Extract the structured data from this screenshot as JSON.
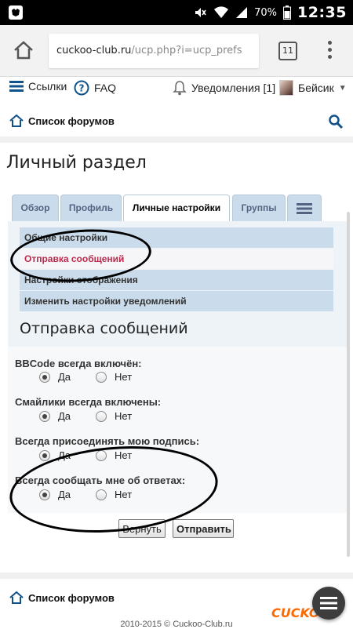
{
  "status_bar": {
    "battery_percent": "70%",
    "time": "12:35"
  },
  "browser": {
    "url_domain": "cuckoo-club.ru",
    "url_path": "/ucp.php?i=ucp_prefs",
    "tab_count": "11"
  },
  "top_nav": {
    "links_label": "Ссылки",
    "faq_label": "FAQ",
    "notifications_label": "Уведомления",
    "notifications_count": "[1]",
    "user_name": "Бейсик"
  },
  "breadcrumb": {
    "forum_list": "Список форумов"
  },
  "page": {
    "title": "Личный раздел"
  },
  "tabs": [
    {
      "label": "Обзор"
    },
    {
      "label": "Профиль"
    },
    {
      "label": "Личные настройки"
    },
    {
      "label": "Группы"
    }
  ],
  "submenu": [
    {
      "label": "Общие настройки"
    },
    {
      "label": "Отправка сообщений"
    },
    {
      "label": "Настройки отображения"
    },
    {
      "label": "Изменить настройки уведомлений"
    }
  ],
  "section": {
    "heading": "Отправка сообщений"
  },
  "options": [
    {
      "label": "BBCode всегда включён:",
      "yes": "Да",
      "no": "Нет",
      "selected": "yes"
    },
    {
      "label": "Смайлики всегда включены:",
      "yes": "Да",
      "no": "Нет",
      "selected": "yes"
    },
    {
      "label": "Всегда присоединять мою подпись:",
      "yes": "Да",
      "no": "Нет",
      "selected": "yes"
    },
    {
      "label": "Всегда сообщать мне об ответах:",
      "yes": "Да",
      "no": "Нет",
      "selected": "yes"
    }
  ],
  "buttons": {
    "reset": "Вернуть",
    "submit": "Отправить"
  },
  "footer": {
    "forum_list": "Список форумов",
    "copyright": "2010-2015 © Cuckoo-Club.ru",
    "brand": "CUCKOO"
  },
  "colors": {
    "tab_bg": "#cadceb",
    "active_menu_text": "#bc2a4d",
    "link_blue": "#536482"
  }
}
